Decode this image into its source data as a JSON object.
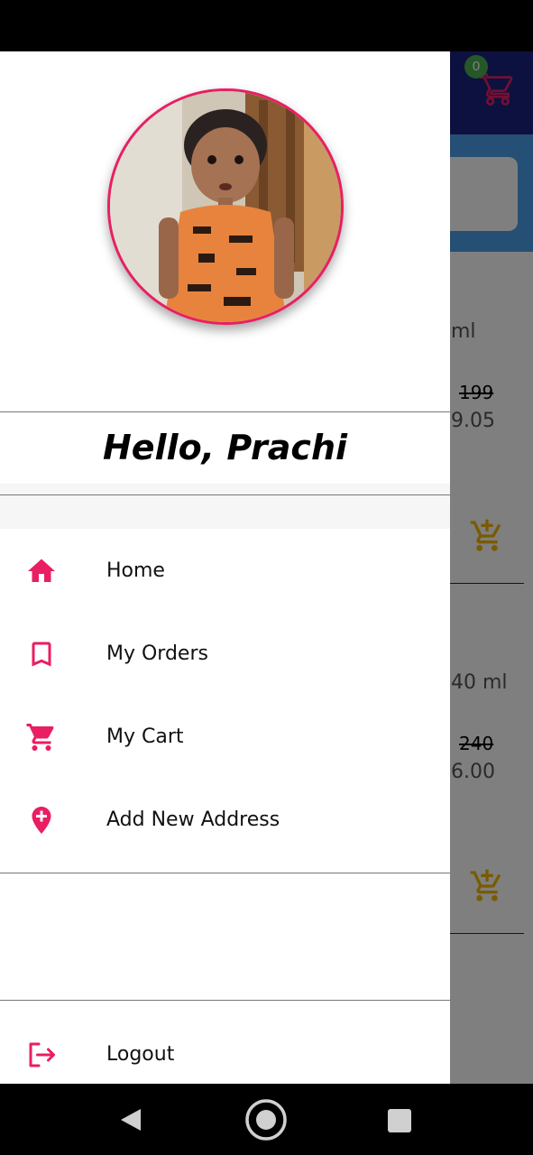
{
  "background": {
    "cart_badge_count": "0",
    "products": [
      {
        "unit_text": "ml",
        "mrp": "199",
        "price": "9.05"
      },
      {
        "unit_text": "40 ml",
        "mrp": "240",
        "price": "6.00"
      }
    ]
  },
  "drawer": {
    "greeting": "Hello, Prachi",
    "menu": [
      {
        "label": "Home",
        "icon": "home-icon"
      },
      {
        "label": "My Orders",
        "icon": "bookmark-icon"
      },
      {
        "label": "My Cart",
        "icon": "cart-icon"
      },
      {
        "label": "Add New Address",
        "icon": "add-location-icon"
      }
    ],
    "logout_label": "Logout",
    "logout_icon": "logout-icon"
  },
  "colors": {
    "accent": "#e91e63",
    "appbar": "#1a237e",
    "search_band": "#4a9ee8",
    "badge": "#4caf50",
    "add_to_cart": "#f2b705"
  },
  "system_nav": [
    "back-icon",
    "home-circle-icon",
    "recents-icon"
  ]
}
